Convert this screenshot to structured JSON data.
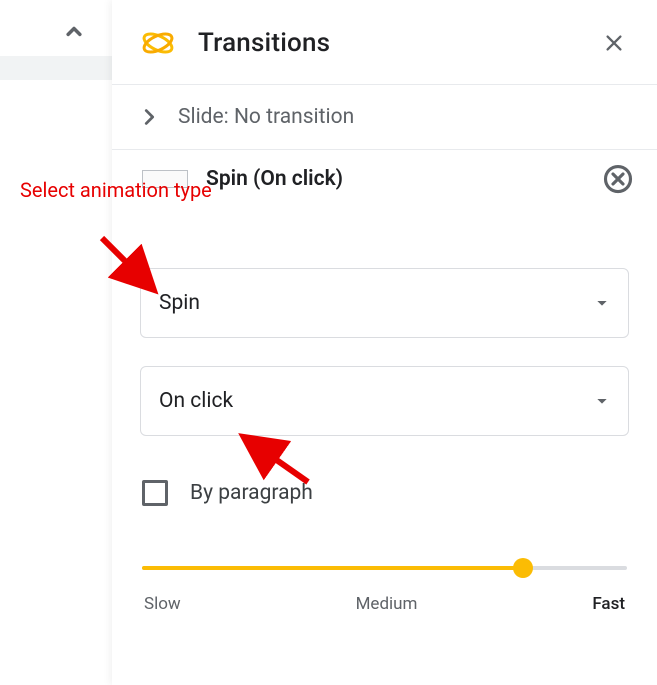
{
  "header": {
    "title": "Transitions"
  },
  "slide_section": {
    "label": "Slide: No transition"
  },
  "annotation": {
    "label": "Select animation type"
  },
  "animation": {
    "summary": "Spin  (On click)",
    "type_select": "Spin",
    "trigger_select": "On click",
    "by_paragraph_label": "By paragraph"
  },
  "speed": {
    "slow": "Slow",
    "medium": "Medium",
    "fast": "Fast"
  }
}
